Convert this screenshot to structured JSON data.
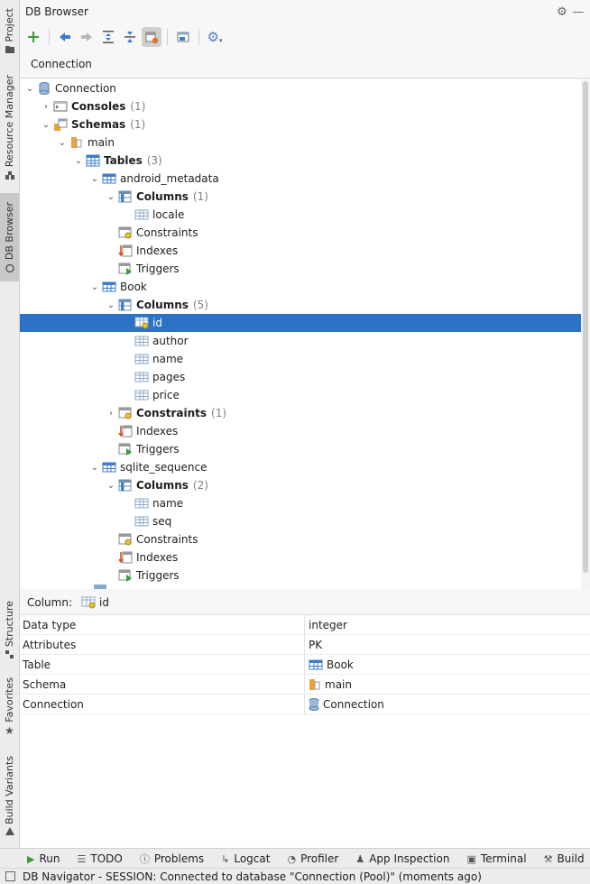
{
  "strip": {
    "project": "Project",
    "resource_manager": "Resource Manager",
    "db_browser": "DB Browser",
    "structure": "Structure",
    "favorites": "Favorites",
    "build_variants": "Build Variants"
  },
  "panel": {
    "title": "DB Browser"
  },
  "connection_header": "Connection",
  "tree": {
    "connection": "Connection",
    "consoles": "Consoles",
    "consoles_count": "(1)",
    "schemas": "Schemas",
    "schemas_count": "(1)",
    "main": "main",
    "tables": "Tables",
    "tables_count": "(3)",
    "t1": "android_metadata",
    "t1_columns": "Columns",
    "t1_columns_count": "(1)",
    "t1_col1": "locale",
    "constraints": "Constraints",
    "indexes": "Indexes",
    "triggers": "Triggers",
    "t2": "Book",
    "t2_columns": "Columns",
    "t2_columns_count": "(5)",
    "t2_col1": "id",
    "t2_col2": "author",
    "t2_col3": "name",
    "t2_col4": "pages",
    "t2_col5": "price",
    "t2_constraints_count": "(1)",
    "t3": "sqlite_sequence",
    "t3_columns": "Columns",
    "t3_columns_count": "(2)",
    "t3_col1": "name",
    "t3_col2": "seq"
  },
  "details": {
    "header_label": "Column:",
    "header_value": "id",
    "rows": [
      {
        "key": "Data type",
        "value": "integer"
      },
      {
        "key": "Attributes",
        "value": "PK"
      },
      {
        "key": "Table",
        "value": "Book"
      },
      {
        "key": "Schema",
        "value": "main"
      },
      {
        "key": "Connection",
        "value": "Connection"
      }
    ]
  },
  "bottom_tabs": [
    "Run",
    "TODO",
    "Problems",
    "Logcat",
    "Profiler",
    "App Inspection",
    "Terminal",
    "Build"
  ],
  "status": "DB Navigator  - SESSION: Connected to database \"Connection (Pool)\" (moments ago)",
  "colors": {
    "selection": "#2c72c7",
    "table_icon": "#3d7cc9",
    "schema_icon": "#e8a33d"
  }
}
